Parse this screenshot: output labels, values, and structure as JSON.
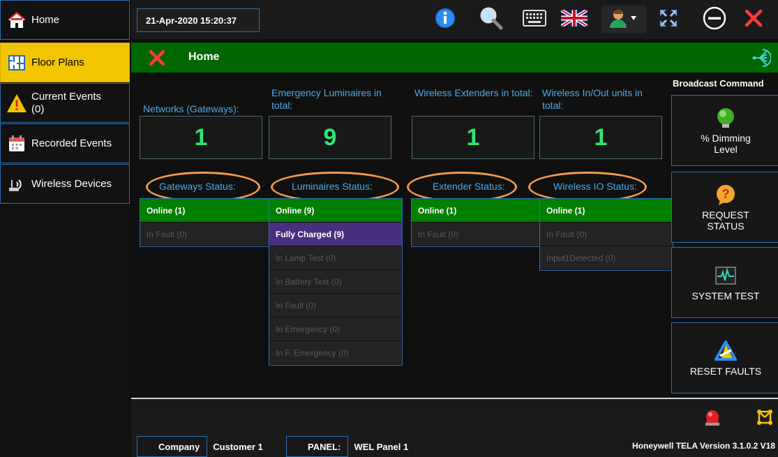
{
  "sidebar": {
    "items": [
      {
        "label": "Home",
        "icon": "home-icon"
      },
      {
        "label": "Floor Plans",
        "icon": "floor-plan-icon"
      },
      {
        "label": "Current Events",
        "sub": "(0)",
        "icon": "warning-icon"
      },
      {
        "label": "Recorded Events",
        "icon": "calendar-icon"
      },
      {
        "label": "Wireless Devices",
        "icon": "wireless-router-icon"
      }
    ]
  },
  "topbar": {
    "datetime": "21-Apr-2020 15:20:37",
    "icons": [
      "info-icon",
      "search-icon",
      "keyboard-icon",
      "uk-flag-icon",
      "user-menu-icon",
      "fullscreen-icon",
      "minimize-icon",
      "close-icon"
    ]
  },
  "titlebar": {
    "title": "Home"
  },
  "summary": [
    {
      "title": "Networks (Gateways):",
      "count": "1"
    },
    {
      "title": "Emergency Luminaires in total:",
      "count": "9"
    },
    {
      "title": "Wireless Extenders in total:",
      "count": "1"
    },
    {
      "title": "Wireless In/Out units in total:",
      "count": "1"
    }
  ],
  "statuses": [
    {
      "title": "Gateways Status:",
      "rows": [
        "Online  (1)",
        "In Fault  (0)"
      ]
    },
    {
      "title": "Luminaires Status:",
      "rows": [
        "Online  (9)",
        "Fully Charged  (9)",
        "In Lamp Test  (0)",
        "In Battery Test  (0)",
        "In Fault  (0)",
        "In Emergency  (0)",
        "In F. Emergency (0)"
      ]
    },
    {
      "title": "Extender Status:",
      "rows": [
        "Online  (1)",
        "In Fault  (0)"
      ]
    },
    {
      "title": "Wireless IO Status:",
      "rows": [
        "Online  (1)",
        "In Fault  (0)",
        "Input1Detected  (0)"
      ]
    }
  ],
  "broadcast": {
    "title": "Broadcast Command",
    "buttons": [
      {
        "label": "% Dimming Level",
        "icon": "dimming-bulb-icon"
      },
      {
        "label": "REQUEST STATUS",
        "icon": "question-bubble-icon"
      },
      {
        "label": "SYSTEM TEST",
        "icon": "heartbeat-icon"
      },
      {
        "label": "RESET FAULTS",
        "icon": "reset-triangle-icon"
      }
    ]
  },
  "bottom": {
    "company_label": "Company",
    "company_value": "Customer 1",
    "panel_label": "PANEL:",
    "panel_value": "WEL Panel 1",
    "version": "Honeywell TELA Version 3.1.0.2 V18"
  },
  "colors": {
    "accent_blue": "#2b6fb3",
    "active_yellow": "#f2c500",
    "online_green": "#008000",
    "title_green": "#006600",
    "count_green": "#2ee86e",
    "highlight_orange": "#f39a4a"
  }
}
